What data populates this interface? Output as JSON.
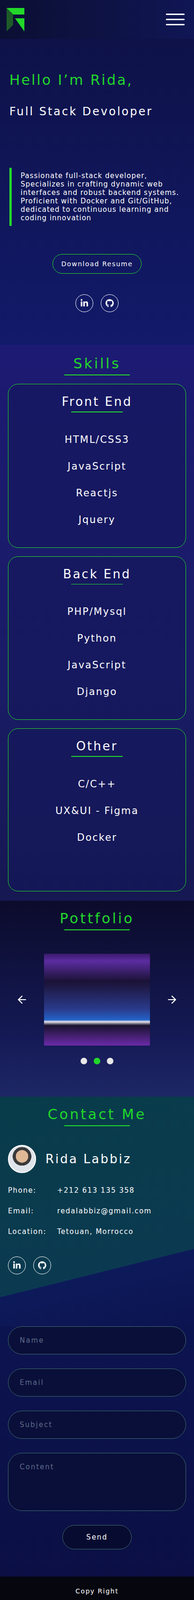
{
  "hero": {
    "greeting": "Hello I’m Rida,",
    "role": "Full Stack Devoloper",
    "description": "Passionate full-stack developer, Specializes in crafting dynamic web interfaces and robust backend systems. Proficient with Docker and Git/GitHub, dedicated to continuous learning and coding innovation",
    "button": "Download Resume"
  },
  "skills": {
    "title": "Skills",
    "groups": [
      {
        "title": "Front End",
        "items": [
          "HTML/CSS3",
          "JavaScript",
          "Reactjs",
          "Jquery"
        ]
      },
      {
        "title": "Back End",
        "items": [
          "PHP/Mysql",
          "Python",
          "JavaScript",
          "Django"
        ]
      },
      {
        "title": "Other",
        "items": [
          "C/C++",
          "UX&UI - Figma",
          "Docker"
        ]
      }
    ]
  },
  "portfolio": {
    "title": "Pottfolio",
    "slides": [
      {
        "selected": false
      },
      {
        "selected": true
      },
      {
        "selected": false
      }
    ]
  },
  "contact": {
    "title": "Contact Me",
    "name": "Rida Labbiz",
    "details": [
      {
        "label": "Phone:",
        "value": "+212 613 135 358"
      },
      {
        "label": "Email:",
        "value": "redalabbiz@gmail.com"
      },
      {
        "label": "Location:",
        "value": "Tetouan, Morrocco"
      }
    ]
  },
  "form": {
    "fields": [
      {
        "placeholder": "Name",
        "kind": "input"
      },
      {
        "placeholder": "Email",
        "kind": "input"
      },
      {
        "placeholder": "Subject",
        "kind": "input"
      },
      {
        "placeholder": "Content",
        "kind": "textarea"
      }
    ],
    "button": "Send"
  },
  "footer": {
    "text": "Copy Right"
  }
}
